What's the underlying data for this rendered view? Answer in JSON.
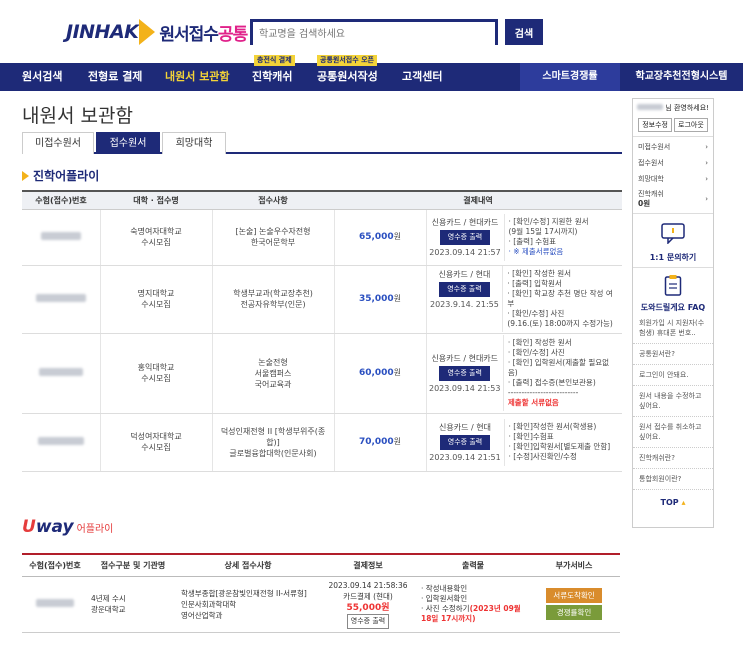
{
  "header": {
    "logo_main": "JINHAK",
    "logo_sub_a": "원서접수",
    "logo_sub_b": "공통",
    "search_placeholder": "학교명을 검색하세요",
    "search_button": "검색"
  },
  "nav": {
    "items": [
      {
        "label": "원서검색"
      },
      {
        "label": "전형료 결제"
      },
      {
        "label": "내원서 보관함"
      },
      {
        "label": "진학캐쉬",
        "badge": "충전식 결제"
      },
      {
        "label": "공통원서작성",
        "badge": "공통원서접수 오픈"
      },
      {
        "label": "고객센터"
      }
    ],
    "right_a": "스마트경쟁률",
    "right_b": "학교장추천전형시스템"
  },
  "page_title": "내원서 보관함",
  "tabs": [
    "미접수원서",
    "접수원서",
    "희망대학"
  ],
  "section_title": "진학어플라이",
  "jinhak_table": {
    "headers": [
      "수험(접수)번호",
      "대학 · 접수명",
      "접수사항",
      "결제내역",
      "출력물"
    ],
    "rows": [
      {
        "univ": "숙명여자대학교",
        "univ_sub": "수시모집",
        "items": [
          "[논술] 논술우수자전형",
          "한국어문학부"
        ],
        "price": "65,000",
        "unit": "원",
        "pay": "신용카드 / 현대카드",
        "receipt": "영수증 출력",
        "date": "2023.09.14 21:57",
        "outputs": [
          "· [확인/수정] 지원한 원서",
          "  (9월 15일 17시까지)",
          "· [출력] 수험표",
          "· ※ 제출서류없음"
        ]
      },
      {
        "univ": "명지대학교",
        "univ_sub": "수시모집",
        "items": [
          "학생부교과(학교장추천)",
          "전공자유학부(인문)"
        ],
        "price": "35,000",
        "unit": "원",
        "pay": "신용카드 / 현대",
        "receipt": "영수증 출력",
        "date": "2023.9.14. 21:55",
        "outputs": [
          "· [확인] 작성한 원서",
          "· [출력] 입학원서",
          "· [확인] 학교장 추천 명단 작성 여부",
          "· [확인/수정] 사진",
          "  (9.16.(토) 18:00까지 수정가능)"
        ]
      },
      {
        "univ": "홍익대학교",
        "univ_sub": "수시모집",
        "items": [
          "논술전형",
          "서울캠퍼스",
          "국어교육과"
        ],
        "price": "60,000",
        "unit": "원",
        "pay": "신용카드 / 현대카드",
        "receipt": "영수증 출력",
        "date": "2023.09.14 21:53",
        "outputs": [
          "· [확인] 작성한 원서",
          "· [확인/수정] 사진",
          "· [확인] 입학원서(제출할 필요없음)",
          "· [출력] 접수증(본인보관용)",
          "--------------------------",
          "제출할 서류없음"
        ]
      },
      {
        "univ": "덕성여자대학교",
        "univ_sub": "수시모집",
        "items": [
          "덕성인재전형 II [학생부위주(종",
          "합)]",
          "글로벌융합대학(인문사회)"
        ],
        "price": "70,000",
        "unit": "원",
        "pay": "신용카드 / 현대",
        "receipt": "영수증 출력",
        "date": "2023.09.14 21:51",
        "outputs": [
          "· [확인]작성한 원서(학생용)",
          "· [확인]수험표",
          "· [확인]입학원서[별도제출 안함]",
          "· [수정]사진확인/수정"
        ]
      }
    ]
  },
  "uway": {
    "logo_a": "U",
    "logo_b": "way",
    "logo_sub": "어플라이",
    "headers": [
      "수험(접수)번호",
      "접수구분 및 기관명",
      "상세 접수사항",
      "결제정보",
      "출력물",
      "부가서비스"
    ],
    "row": {
      "type": "4년제 수시",
      "univ": "광운대학교",
      "details": [
        "학생부종합[광운참빛인재전형 II-서류형]",
        "인문사회과학대학",
        "영어산업학과"
      ],
      "date": "2023.09.14 21:58:36",
      "pay": "카드결제 (현대)",
      "price": "55,000원",
      "receipt": "영수증 출력",
      "outputs": [
        "· 작성내용확인",
        "· 입학원서확인",
        "· 사진 수정하기"
      ],
      "output_deadline": "(2023년 09월 18일 17시까지)",
      "svc_a": "서류도착확인",
      "svc_b": "경쟁률확인"
    }
  },
  "sidebar": {
    "greeting": "님 환영하세요!",
    "btn_info": "정보수정",
    "btn_logout": "로그아웃",
    "menu": [
      "미접수원서",
      "접수원서",
      "희망대학",
      "진학캐쉬"
    ],
    "cash": "0원",
    "qna": "1:1 문의하기",
    "faq_title": "도와드릴게요 FAQ",
    "faq": [
      "회원가입 시 지원자(수험생) 휴대폰 번호..",
      "공통원서란?",
      "로그인이 안돼요.",
      "원서 내용을 수정하고 싶어요.",
      "원서 접수를 취소하고 싶어요.",
      "진학캐쉬란?",
      "통합회원이란?"
    ],
    "top": "TOP"
  }
}
